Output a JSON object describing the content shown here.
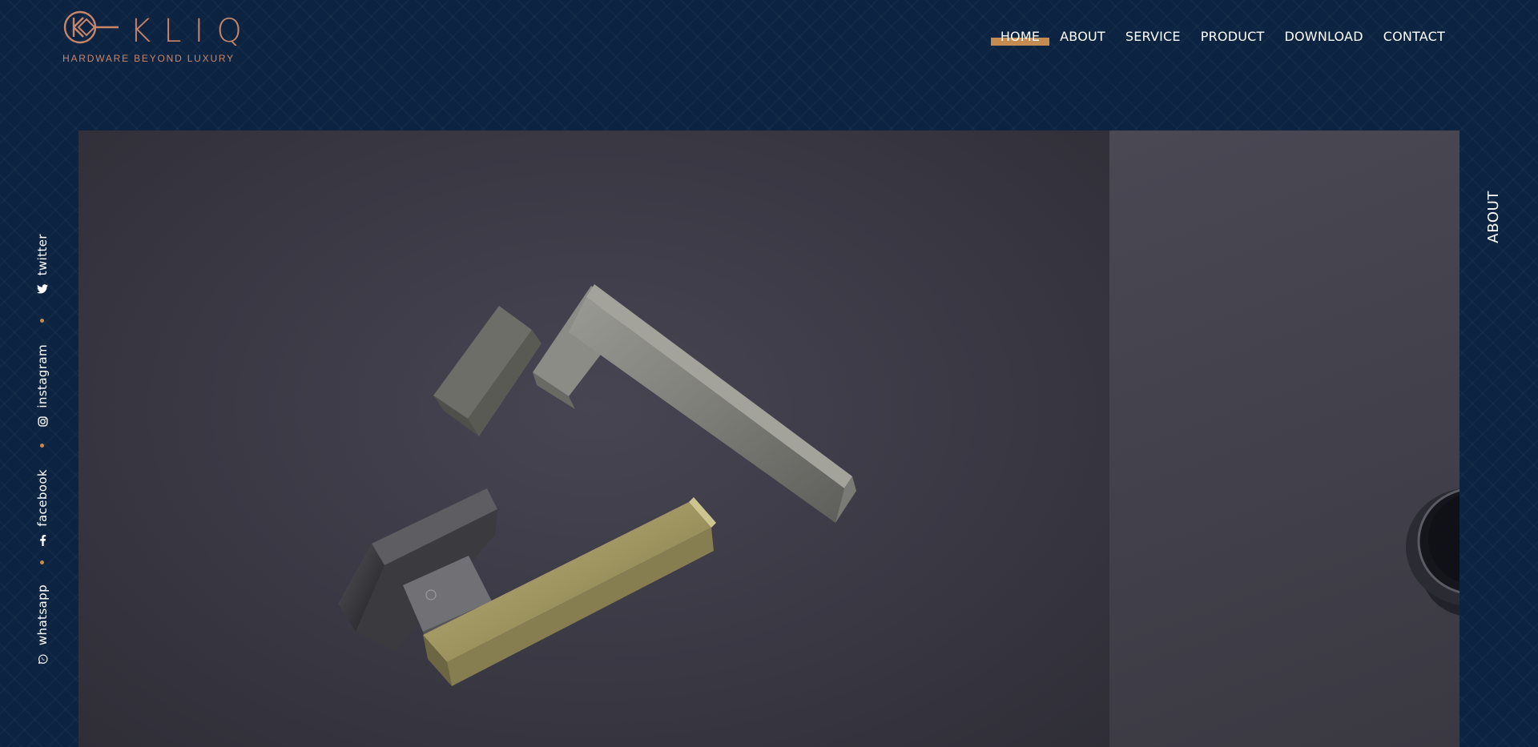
{
  "brand": {
    "name": "KLIQ",
    "tagline": "HARDWARE BEYOND LUXURY",
    "accent_color": "#c58c52",
    "logo_color": "#c9856a",
    "background_color": "#0c2441"
  },
  "nav": {
    "items": [
      {
        "label": "HOME",
        "active": true
      },
      {
        "label": "ABOUT",
        "active": false
      },
      {
        "label": "SERVICE",
        "active": false
      },
      {
        "label": "PRODUCT",
        "active": false
      },
      {
        "label": "DOWNLOAD",
        "active": false
      },
      {
        "label": "CONTACT",
        "active": false
      }
    ]
  },
  "social": {
    "items": [
      {
        "label": "twitter",
        "icon": "twitter-icon"
      },
      {
        "label": "instagram",
        "icon": "instagram-icon"
      },
      {
        "label": "facebook",
        "icon": "facebook-icon"
      },
      {
        "label": "whatsapp",
        "icon": "whatsapp-icon"
      }
    ]
  },
  "slider": {
    "current_image": "door-handle-pair-photo",
    "next_image": "round-knob-photo"
  },
  "side": {
    "label": "ABOUT"
  }
}
